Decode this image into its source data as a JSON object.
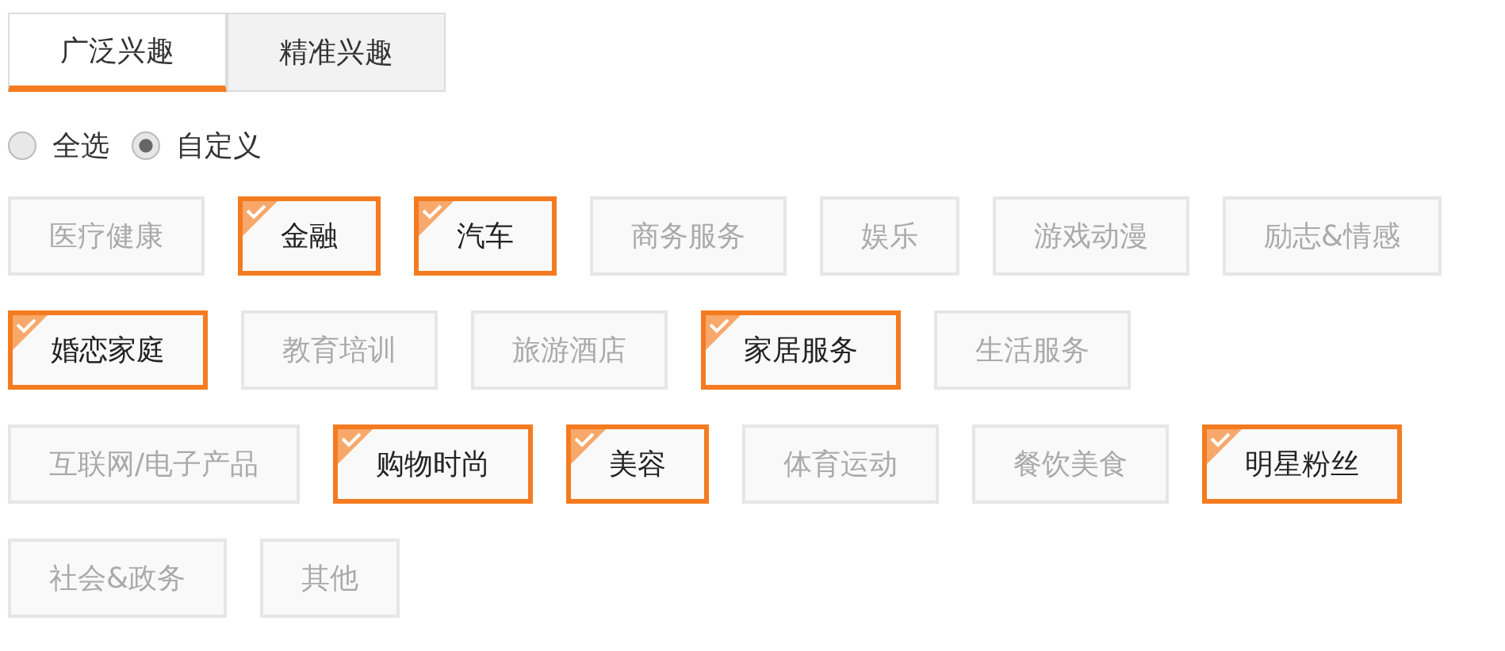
{
  "tabs": [
    {
      "label": "广泛兴趣",
      "selected": true
    },
    {
      "label": "精准兴趣",
      "selected": false
    }
  ],
  "scope_options": [
    {
      "label": "全选",
      "selected": false
    },
    {
      "label": "自定义",
      "selected": true
    }
  ],
  "interest_rows": [
    [
      {
        "label": "医疗健康",
        "selected": false
      },
      {
        "label": "金融",
        "selected": true
      },
      {
        "label": "汽车",
        "selected": true
      },
      {
        "label": "商务服务",
        "selected": false
      },
      {
        "label": "娱乐",
        "selected": false
      },
      {
        "label": "游戏动漫",
        "selected": false
      },
      {
        "label": "励志&情感",
        "selected": false
      }
    ],
    [
      {
        "label": "婚恋家庭",
        "selected": true
      },
      {
        "label": "教育培训",
        "selected": false
      },
      {
        "label": "旅游酒店",
        "selected": false
      },
      {
        "label": "家居服务",
        "selected": true
      },
      {
        "label": "生活服务",
        "selected": false
      }
    ],
    [
      {
        "label": "互联网/电子产品",
        "selected": false
      },
      {
        "label": "购物时尚",
        "selected": true
      },
      {
        "label": "美容",
        "selected": true
      },
      {
        "label": "体育运动",
        "selected": false
      },
      {
        "label": "餐饮美食",
        "selected": false
      },
      {
        "label": "明星粉丝",
        "selected": true
      }
    ],
    [
      {
        "label": "社会&政务",
        "selected": false
      },
      {
        "label": "其他",
        "selected": false
      }
    ]
  ]
}
